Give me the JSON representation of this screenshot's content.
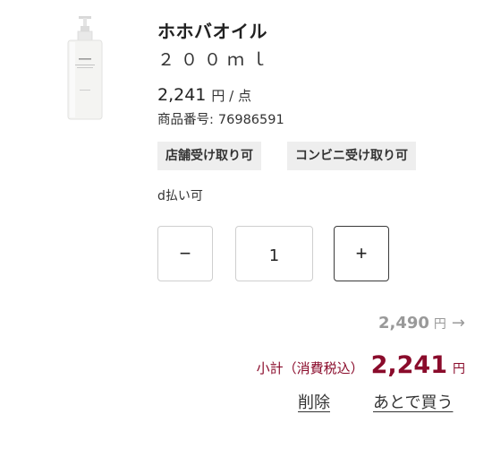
{
  "product": {
    "name": "ホホバオイル",
    "variant": "２００ｍｌ",
    "price": "2,241",
    "price_unit": "円 / 点",
    "code_label": "商品番号:",
    "code": "76986591",
    "image_alt": "product-bottle"
  },
  "tags": {
    "store_pickup": "店舗受け取り可",
    "convenience_pickup": "コンビニ受け取り可"
  },
  "payment_note": "d払い可",
  "quantity": {
    "minus_label": "−",
    "value": "1",
    "plus_label": "+"
  },
  "totals": {
    "original_price": "2,490",
    "original_unit": "円",
    "arrow": "→",
    "subtotal_label": "小計（消費税込）",
    "subtotal_value": "2,241",
    "subtotal_unit": "円"
  },
  "actions": {
    "delete": "削除",
    "save_for_later": "あとで買う"
  },
  "colors": {
    "subtotal_accent": "#8a0b2b",
    "muted_text": "#999999",
    "tag_background": "#eeeeee"
  }
}
